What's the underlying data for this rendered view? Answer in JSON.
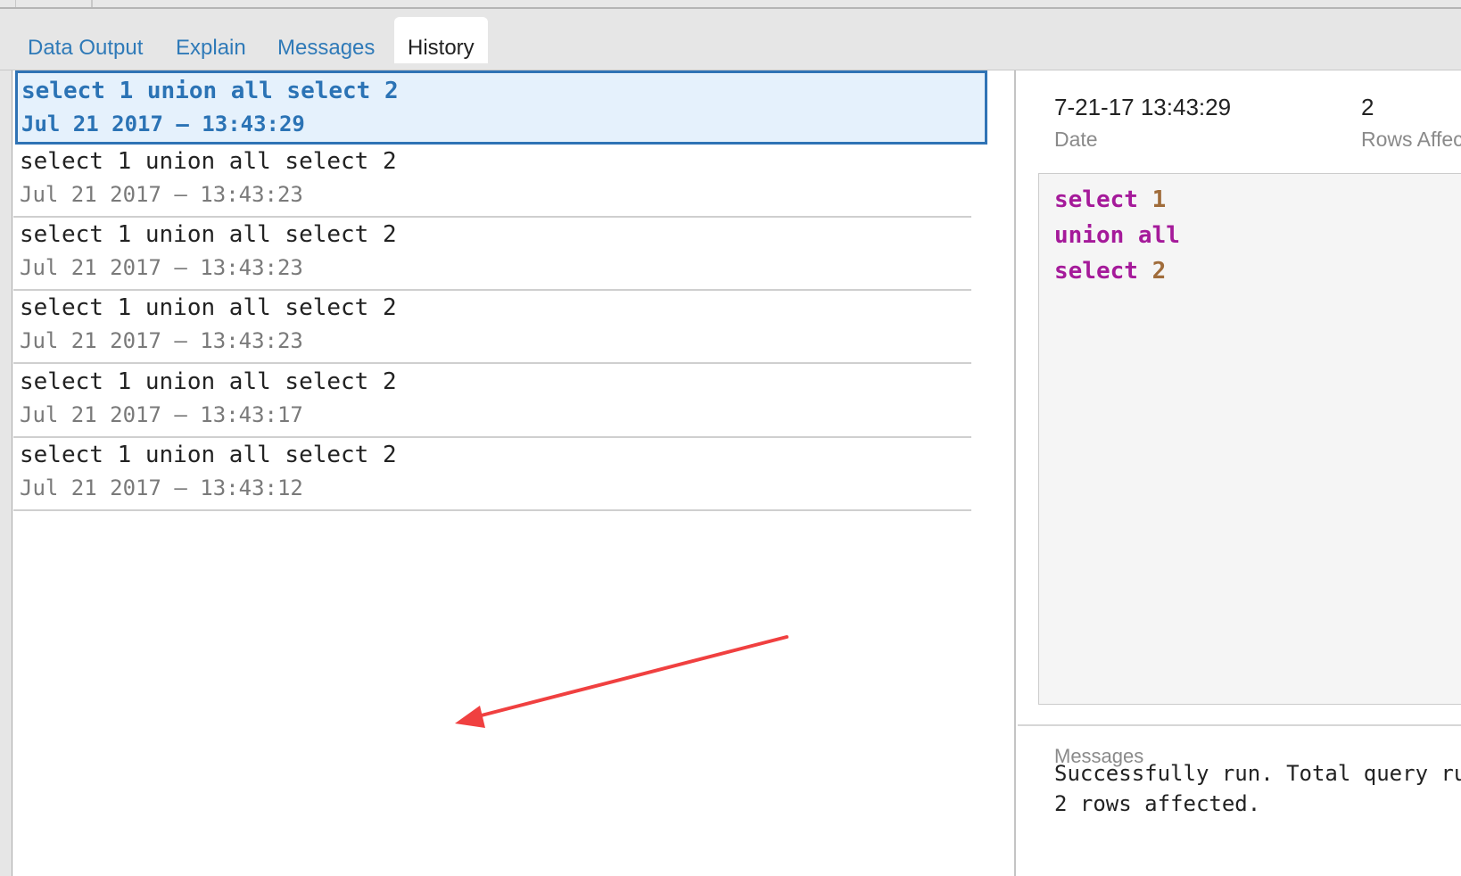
{
  "tabs": [
    {
      "label": "Data Output",
      "active": false
    },
    {
      "label": "Explain",
      "active": false
    },
    {
      "label": "Messages",
      "active": false
    },
    {
      "label": "History",
      "active": true
    }
  ],
  "history": {
    "items": [
      {
        "query": "select 1 union all select 2",
        "time": "Jul 21 2017 — 13:43:29",
        "selected": true
      },
      {
        "query": "select 1 union all select 2",
        "time": "Jul 21 2017 — 13:43:23",
        "selected": false
      },
      {
        "query": "select 1 union all select 2",
        "time": "Jul 21 2017 — 13:43:23",
        "selected": false
      },
      {
        "query": "select 1 union all select 2",
        "time": "Jul 21 2017 — 13:43:23",
        "selected": false
      },
      {
        "query": "select 1 union all select 2",
        "time": "Jul 21 2017 — 13:43:17",
        "selected": false
      },
      {
        "query": "select 1 union all select 2",
        "time": "Jul 21 2017 — 13:43:12",
        "selected": false
      }
    ]
  },
  "detail": {
    "date_value": "7-21-17 13:43:29",
    "date_label": "Date",
    "rows_value": "2",
    "rows_label": "Rows Affected",
    "code": {
      "line1_kw": "select",
      "line1_num": "1",
      "line2_kw": "union all",
      "line3_kw": "select",
      "line3_num": "2"
    },
    "messages_label": "Messages",
    "messages_line1": "Successfully run. Total query runtime",
    "messages_line2": "2 rows affected."
  },
  "colors": {
    "accent": "#2f73b5",
    "selected_bg": "#e5f1fc",
    "keyword": "#a51a9a",
    "number": "#a06c3a",
    "annotation_arrow": "#f04040"
  }
}
